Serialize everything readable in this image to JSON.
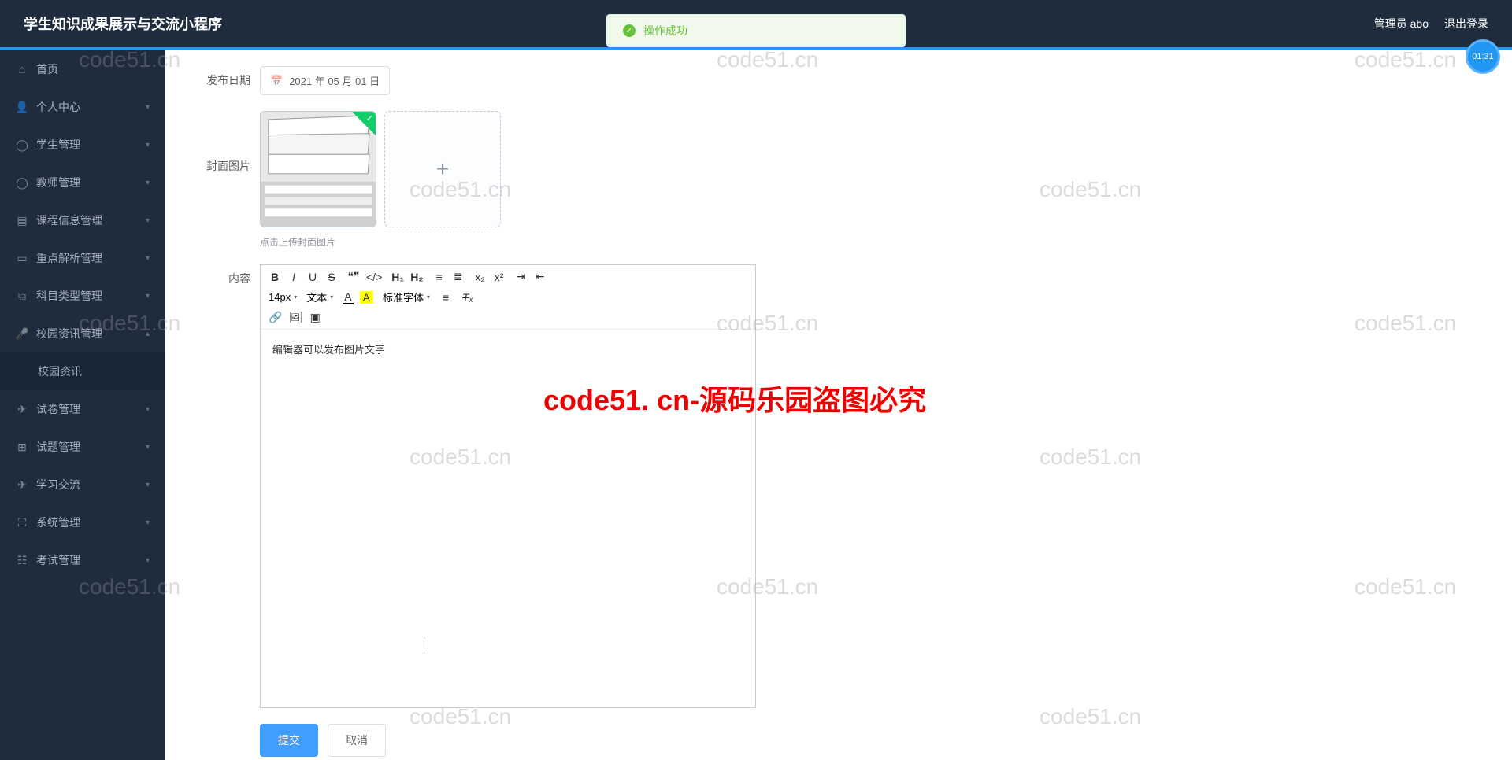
{
  "header": {
    "title": "学生知识成果展示与交流小程序",
    "admin_label": "管理员 abo",
    "logout_label": "退出登录"
  },
  "toast": {
    "text": "操作成功"
  },
  "timer": "01:31",
  "sidebar": {
    "items": [
      {
        "label": "首页",
        "icon": "home",
        "expandable": false
      },
      {
        "label": "个人中心",
        "icon": "user",
        "expandable": true
      },
      {
        "label": "学生管理",
        "icon": "compass",
        "expandable": true
      },
      {
        "label": "教师管理",
        "icon": "compass",
        "expandable": true
      },
      {
        "label": "课程信息管理",
        "icon": "book",
        "expandable": true
      },
      {
        "label": "重点解析管理",
        "icon": "doc",
        "expandable": true
      },
      {
        "label": "科目类型管理",
        "icon": "copy",
        "expandable": true
      },
      {
        "label": "校园资讯管理",
        "icon": "mic",
        "expandable": true,
        "expanded": true,
        "children": [
          {
            "label": "校园资讯"
          }
        ]
      },
      {
        "label": "试卷管理",
        "icon": "send",
        "expandable": true
      },
      {
        "label": "试题管理",
        "icon": "grid",
        "expandable": true
      },
      {
        "label": "学习交流",
        "icon": "send",
        "expandable": true
      },
      {
        "label": "系统管理",
        "icon": "expand",
        "expandable": true
      },
      {
        "label": "考试管理",
        "icon": "layers",
        "expandable": true
      }
    ]
  },
  "form": {
    "date_label": "发布日期",
    "date_value": "2021 年 05 月 01 日",
    "cover_label": "封面图片",
    "upload_hint": "点击上传封面图片",
    "content_label": "内容",
    "editor_text": "编辑器可以发布图片文字",
    "toolbar": {
      "font_size": "14px",
      "para": "文本",
      "font_family": "标准字体"
    },
    "submit": "提交",
    "cancel": "取消"
  },
  "watermarks": {
    "text": "code51.cn",
    "banner": "code51. cn-源码乐园盗图必究"
  }
}
